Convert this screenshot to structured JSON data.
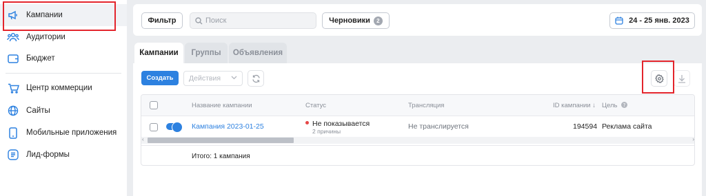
{
  "sidebar": {
    "items": [
      {
        "label": "Кампании",
        "icon": "megaphone-icon"
      },
      {
        "label": "Аудитории",
        "icon": "people-icon"
      },
      {
        "label": "Бюджет",
        "icon": "wallet-icon"
      },
      {
        "label": "Центр коммерции",
        "icon": "cart-icon"
      },
      {
        "label": "Сайты",
        "icon": "globe-icon"
      },
      {
        "label": "Мобильные приложения",
        "icon": "phone-icon"
      },
      {
        "label": "Лид-формы",
        "icon": "form-icon"
      }
    ]
  },
  "topbar": {
    "filter_label": "Фильтр",
    "search_placeholder": "Поиск",
    "drafts_label": "Черновики",
    "drafts_count": "2",
    "date_range": "24 - 25 янв. 2023"
  },
  "tabs": [
    {
      "label": "Кампании"
    },
    {
      "label": "Группы"
    },
    {
      "label": "Объявления"
    }
  ],
  "toolbar": {
    "create_label": "Создать",
    "actions_placeholder": "Действия"
  },
  "table": {
    "columns": {
      "name": "Название кампании",
      "status": "Статус",
      "broadcast": "Трансляция",
      "id": "ID кампании ↓",
      "goal": "Цель"
    },
    "rows": [
      {
        "name": "Кампания 2023-01-25",
        "status": "Не показывается",
        "status_reason": "2 причины",
        "broadcast": "Не транслируется",
        "id": "194594",
        "goal": "Реклама сайта"
      }
    ],
    "total": "Итого: 1 кампания"
  },
  "colors": {
    "accent": "#2d81e0",
    "highlight": "#e3242b",
    "status_dot": "#e64646"
  }
}
